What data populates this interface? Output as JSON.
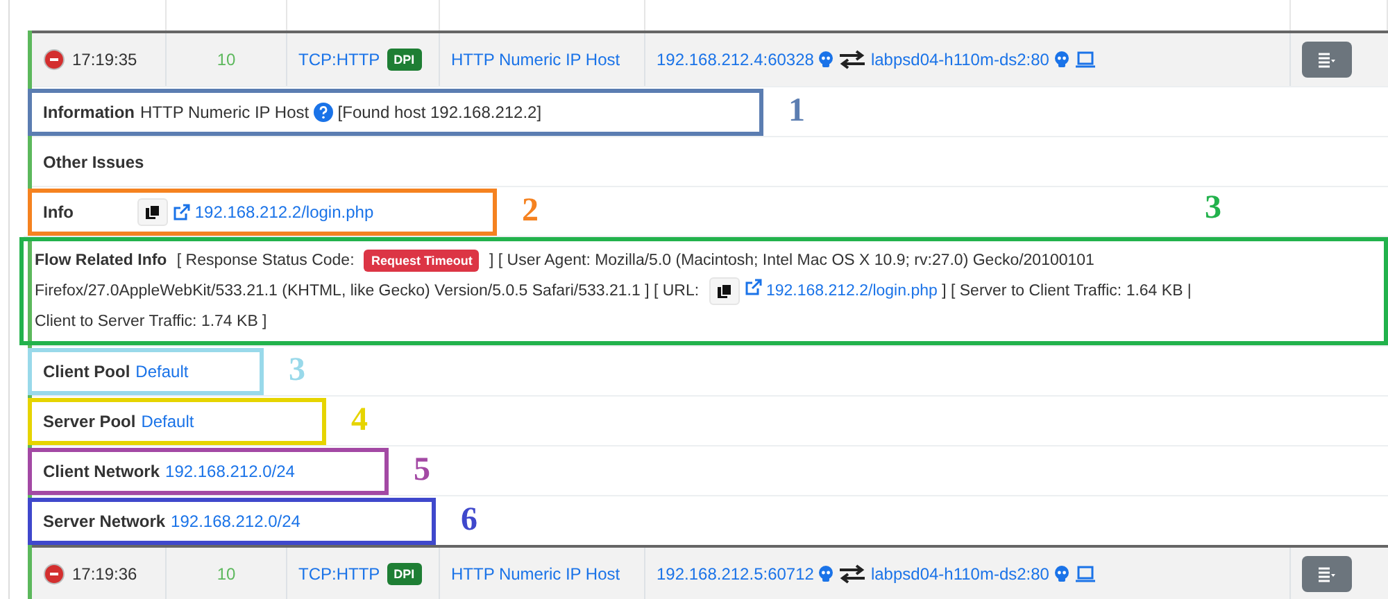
{
  "table": {
    "rows": [
      {
        "time": "17:19:35",
        "score": "10",
        "protocol": "TCP:HTTP",
        "badge": "DPI",
        "alert": "HTTP Numeric IP Host",
        "client": "192.168.212.4:60328",
        "server": "labpsd04-h110m-ds2:80",
        "details": [
          {
            "kind": "information",
            "label": "Information",
            "text": "HTTP Numeric IP Host",
            "note": "[Found host 192.168.212.2]",
            "annotation": {
              "number": "1",
              "color": "#5b7db1"
            }
          },
          {
            "kind": "heading",
            "label": "Other Issues"
          },
          {
            "kind": "link",
            "label": "Info",
            "link": "192.168.212.2/login.php",
            "annotation": {
              "number": "2",
              "color": "#f58220"
            }
          },
          {
            "kind": "flow",
            "label": "Flow Related Info",
            "parts": [
              {
                "kind": "text",
                "text": "[ Response Status Code:"
              },
              {
                "kind": "badge",
                "text": "Request Timeout"
              },
              {
                "kind": "text",
                "text": "] [ User Agent: Mozilla/5.0 (Macintosh; Intel Mac OS X 10.9; rv:27.0) Gecko/20100101"
              },
              {
                "kind": "text",
                "text": "Firefox/27.0AppleWebKit/533.21.1 (KHTML, like Gecko) Version/5.0.5 Safari/533.21.1 ] [ URL:"
              },
              {
                "kind": "link",
                "text": "192.168.212.2/login.php"
              },
              {
                "kind": "text",
                "text": "] [ Server to Client Traffic: 1.64 KB |"
              },
              {
                "kind": "text",
                "text": "Client to Server Traffic: 1.74 KB ]"
              }
            ],
            "annotation": {
              "number": "3",
              "color": "#22b24c"
            }
          },
          {
            "kind": "value",
            "label": "Client Pool",
            "value": "Default",
            "annotation": {
              "number": "3",
              "color": "#99d9ea"
            }
          },
          {
            "kind": "value",
            "label": "Server Pool",
            "value": "Default",
            "annotation": {
              "number": "4",
              "color": "#e6d400"
            }
          },
          {
            "kind": "value",
            "label": "Client Network",
            "value": "192.168.212.0/24",
            "annotation": {
              "number": "5",
              "color": "#a349a4"
            }
          },
          {
            "kind": "value",
            "label": "Server Network",
            "value": "192.168.212.0/24",
            "annotation": {
              "number": "6",
              "color": "#3f48cc"
            }
          }
        ]
      },
      {
        "time": "17:19:36",
        "score": "10",
        "protocol": "TCP:HTTP",
        "badge": "DPI",
        "alert": "HTTP Numeric IP Host",
        "client": "192.168.212.5:60712",
        "server": "labpsd04-h110m-ds2:80"
      }
    ]
  }
}
